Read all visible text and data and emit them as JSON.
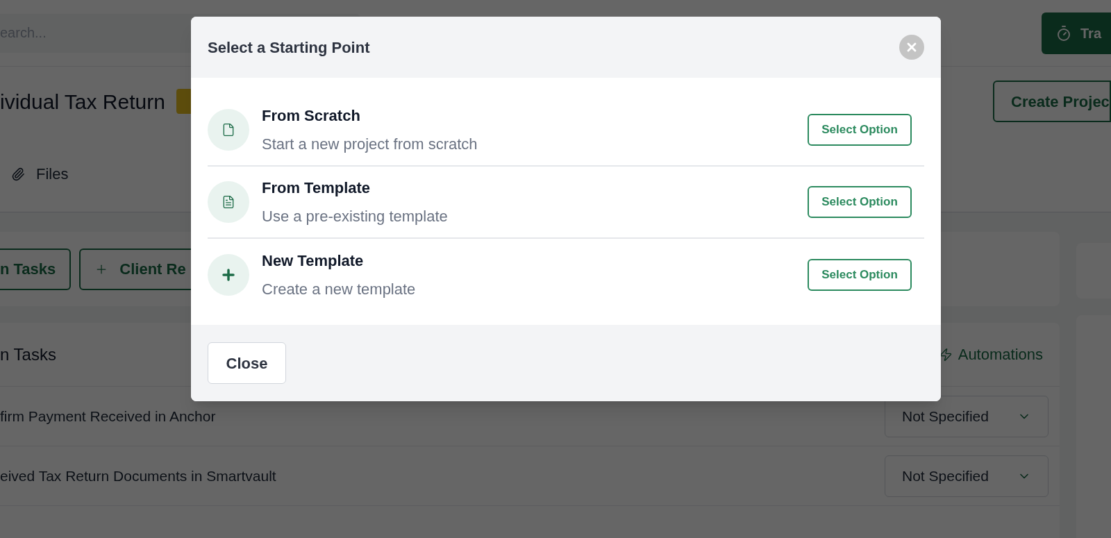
{
  "background": {
    "search": {
      "placeholder": "earch..."
    },
    "track_button": "Tra",
    "title": "ividual Tax Return",
    "create_button": "Create Projec",
    "tabs": [
      {
        "label": "Files"
      }
    ],
    "action_buttons": [
      {
        "kind": "plain",
        "label": "n Tasks"
      },
      {
        "kind": "add",
        "label": "Client Re"
      }
    ],
    "tasks_panel": {
      "title": "n Tasks",
      "automations": "Automations",
      "rows": [
        {
          "name": "firm Payment Received in Anchor",
          "status": "Not Specified"
        },
        {
          "name": "eived Tax Return Documents in Smartvault",
          "status": "Not Specified"
        }
      ]
    }
  },
  "modal": {
    "title": "Select a Starting Point",
    "options": [
      {
        "kind": "blank",
        "title": "From Scratch",
        "description": "Start a new project from scratch",
        "button": "Select Option"
      },
      {
        "kind": "template",
        "title": "From Template",
        "description": "Use a pre-existing template",
        "button": "Select Option"
      },
      {
        "kind": "new",
        "title": "New Template",
        "description": "Create a new template",
        "button": "Select Option"
      }
    ],
    "close_button": "Close"
  }
}
